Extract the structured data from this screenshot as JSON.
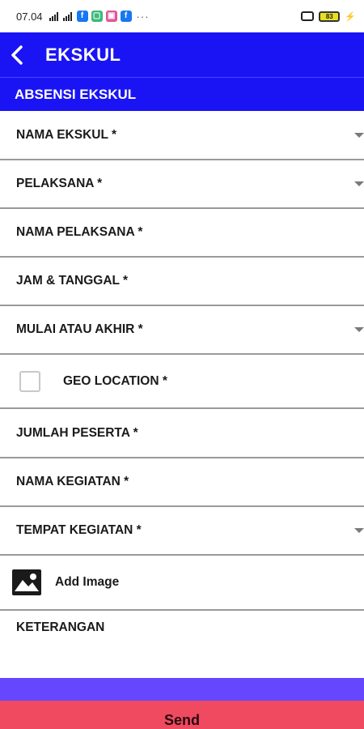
{
  "status_bar": {
    "time": "07.04",
    "signal_icons": [
      "signal-icon",
      "signal-icon"
    ],
    "notification_icons": [
      {
        "name": "facebook-icon",
        "glyph": "f",
        "color": "#1877f2"
      },
      {
        "name": "app-icon",
        "glyph": "▢",
        "color": "#3cba7a"
      },
      {
        "name": "app-icon",
        "glyph": "▣",
        "color": "#e0559b"
      },
      {
        "name": "facebook-icon",
        "glyph": "f",
        "color": "#1877f2"
      }
    ],
    "more_dots": "···",
    "battery_level": "83"
  },
  "app_bar": {
    "title": "EKSKUL",
    "back_icon": "chevron-left-icon",
    "color": "#1a14f5"
  },
  "section": {
    "title": "ABSENSI EKSKUL"
  },
  "form": {
    "nama_ekskul": "NAMA EKSKUL *",
    "pelaksana": "PELAKSANA *",
    "nama_pelaksana": "NAMA PELAKSANA *",
    "jam_tanggal": "JAM & TANGGAL *",
    "mulai_akhir": "MULAI ATAU AKHIR *",
    "geo_location": "GEO LOCATION *",
    "jumlah_peserta": "JUMLAH PESERTA *",
    "nama_kegiatan": "NAMA KEGIATAN *",
    "tempat_kegiatan": "TEMPAT KEGIATAN *",
    "add_image": "Add Image",
    "keterangan": "KETERANGAN"
  },
  "send_button": {
    "label": "Send",
    "color": "#ef4a60"
  },
  "accent_colors": {
    "primary": "#1a14f5",
    "purple_bar": "#6447ff"
  }
}
